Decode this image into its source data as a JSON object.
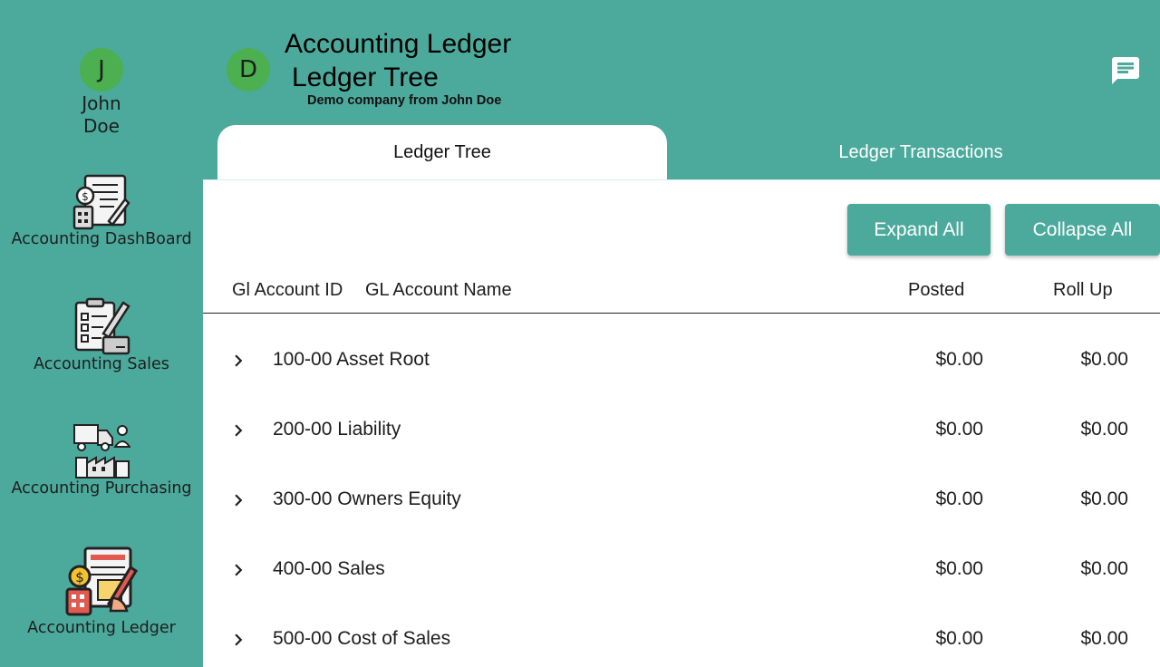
{
  "user": {
    "initial": "J",
    "name": "John Doe"
  },
  "sidebar": {
    "items": [
      {
        "label": "Accounting DashBoard",
        "icon": "accounting-dashboard-icon"
      },
      {
        "label": "Accounting Sales",
        "icon": "accounting-sales-icon"
      },
      {
        "label": "Accounting Purchasing",
        "icon": "accounting-purchasing-icon"
      },
      {
        "label": "Accounting Ledger",
        "icon": "accounting-ledger-icon"
      }
    ]
  },
  "header": {
    "company_initial": "D",
    "title_line1": "Accounting Ledger",
    "title_line2": "Ledger Tree",
    "subtitle": "Demo company from John Doe",
    "chat_icon": "chat-icon"
  },
  "tabs": [
    {
      "label": "Ledger Tree",
      "active": true
    },
    {
      "label": "Ledger Transactions",
      "active": false
    }
  ],
  "actions": {
    "expand_all": "Expand All",
    "collapse_all": "Collapse All"
  },
  "table": {
    "headers": {
      "id": "Gl Account ID",
      "name": "GL Account Name",
      "posted": "Posted",
      "rollup": "Roll Up"
    },
    "rows": [
      {
        "account": "100-00 Asset Root",
        "posted": "$0.00",
        "rollup": "$0.00"
      },
      {
        "account": "200-00 Liability",
        "posted": "$0.00",
        "rollup": "$0.00"
      },
      {
        "account": "300-00 Owners Equity",
        "posted": "$0.00",
        "rollup": "$0.00"
      },
      {
        "account": "400-00 Sales",
        "posted": "$0.00",
        "rollup": "$0.00"
      },
      {
        "account": "500-00 Cost of Sales",
        "posted": "$0.00",
        "rollup": "$0.00"
      }
    ]
  },
  "colors": {
    "accent": "#4caa9c",
    "avatar": "#4caf50",
    "panel": "#ffffff"
  }
}
